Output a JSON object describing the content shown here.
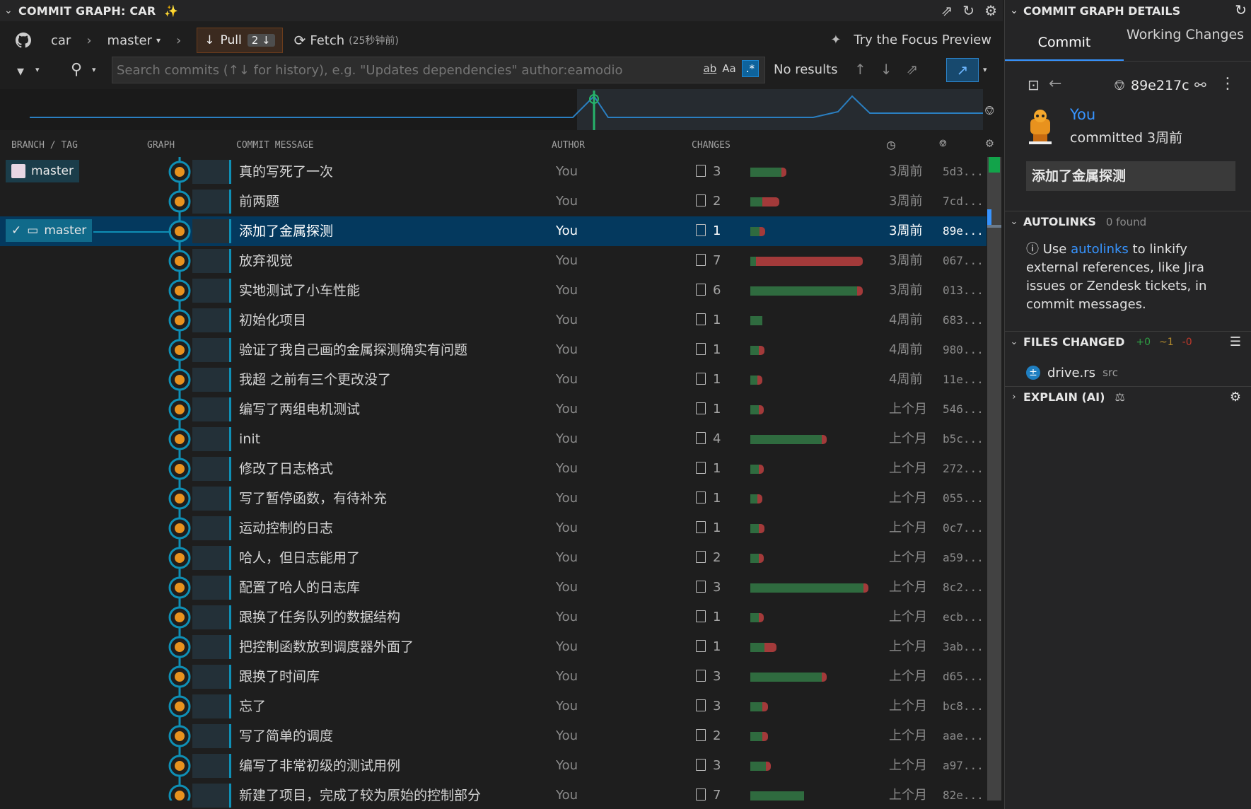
{
  "left_panel": {
    "title": "COMMIT GRAPH: CAR",
    "toolbar": {
      "repo": "car",
      "branch": "master",
      "pull_label": "Pull",
      "pull_count": "2",
      "fetch_label": "Fetch",
      "fetch_time": "(25秒钟前)",
      "focus_preview": "Try the Focus Preview"
    },
    "search": {
      "placeholder": "Search commits (↑↓ for history), e.g. \"Updates dependencies\" author:eamodio",
      "opt_match_word": "ab",
      "opt_match_case": "Aa",
      "opt_regex": ".*",
      "results": "No results"
    },
    "columns": {
      "branch_tag": "BRANCH / TAG",
      "graph": "GRAPH",
      "message": "COMMIT MESSAGE",
      "author": "AUTHOR",
      "changes": "CHANGES"
    },
    "branch_labels": {
      "remote_master": "master",
      "local_master": "master"
    },
    "colors": {
      "accent": "#0f8fb5",
      "additions": "#2f6b3f",
      "deletions": "#a33a3a",
      "selected_row": "#04395e"
    },
    "commits": [
      {
        "message": "真的写死了一次",
        "author": "You",
        "files": "3",
        "add": 0.26,
        "del": 0.04,
        "date": "3周前",
        "sha": "5d3..."
      },
      {
        "message": "前两题",
        "author": "You",
        "files": "2",
        "add": 0.1,
        "del": 0.14,
        "date": "3周前",
        "sha": "7cd..."
      },
      {
        "message": "添加了金属探测",
        "author": "You",
        "files": "1",
        "add": 0.08,
        "del": 0.05,
        "date": "3周前",
        "sha": "89e...",
        "selected": true
      },
      {
        "message": "放弃视觉",
        "author": "You",
        "files": "7",
        "add": 0.05,
        "del": 0.9,
        "date": "3周前",
        "sha": "067..."
      },
      {
        "message": "实地测试了小车性能",
        "author": "You",
        "files": "6",
        "add": 0.9,
        "del": 0.05,
        "date": "3周前",
        "sha": "013..."
      },
      {
        "message": "初始化项目",
        "author": "You",
        "files": "1",
        "add": 0.1,
        "del": 0,
        "date": "4周前",
        "sha": "683..."
      },
      {
        "message": "验证了我自己画的金属探测确实有问题",
        "author": "You",
        "files": "1",
        "add": 0.07,
        "del": 0.05,
        "date": "4周前",
        "sha": "980..."
      },
      {
        "message": "我超 之前有三个更改没了",
        "author": "You",
        "files": "1",
        "add": 0.06,
        "del": 0.04,
        "date": "4周前",
        "sha": "11e..."
      },
      {
        "message": "编写了两组电机测试",
        "author": "You",
        "files": "1",
        "add": 0.07,
        "del": 0.04,
        "date": "上个月",
        "sha": "546..."
      },
      {
        "message": "init",
        "author": "You",
        "files": "4",
        "add": 0.6,
        "del": 0.04,
        "date": "上个月",
        "sha": "b5c..."
      },
      {
        "message": "修改了日志格式",
        "author": "You",
        "files": "1",
        "add": 0.07,
        "del": 0.04,
        "date": "上个月",
        "sha": "272..."
      },
      {
        "message": "写了暂停函数，有待补充",
        "author": "You",
        "files": "1",
        "add": 0.06,
        "del": 0.04,
        "date": "上个月",
        "sha": "055..."
      },
      {
        "message": "运动控制的日志",
        "author": "You",
        "files": "1",
        "add": 0.07,
        "del": 0.05,
        "date": "上个月",
        "sha": "0c7..."
      },
      {
        "message": "哈人，但日志能用了",
        "author": "You",
        "files": "2",
        "add": 0.07,
        "del": 0.04,
        "date": "上个月",
        "sha": "a59..."
      },
      {
        "message": "配置了哈人的日志库",
        "author": "You",
        "files": "3",
        "add": 0.95,
        "del": 0.04,
        "date": "上个月",
        "sha": "8c2..."
      },
      {
        "message": "跟换了任务队列的数据结构",
        "author": "You",
        "files": "1",
        "add": 0.07,
        "del": 0.04,
        "date": "上个月",
        "sha": "ecb..."
      },
      {
        "message": "把控制函数放到调度器外面了",
        "author": "You",
        "files": "1",
        "add": 0.12,
        "del": 0.1,
        "date": "上个月",
        "sha": "3ab..."
      },
      {
        "message": "跟换了时间库",
        "author": "You",
        "files": "3",
        "add": 0.6,
        "del": 0.04,
        "date": "上个月",
        "sha": "d65..."
      },
      {
        "message": "忘了",
        "author": "You",
        "files": "3",
        "add": 0.1,
        "del": 0.05,
        "date": "上个月",
        "sha": "bc8..."
      },
      {
        "message": "写了简单的调度",
        "author": "You",
        "files": "2",
        "add": 0.1,
        "del": 0.05,
        "date": "上个月",
        "sha": "aae..."
      },
      {
        "message": "编写了非常初级的测试用例",
        "author": "You",
        "files": "3",
        "add": 0.13,
        "del": 0.04,
        "date": "上个月",
        "sha": "a97..."
      },
      {
        "message": "新建了项目，完成了较为原始的控制部分",
        "author": "You",
        "files": "7",
        "add": 0.45,
        "del": 0,
        "date": "上个月",
        "sha": "82e..."
      }
    ]
  },
  "right_panel": {
    "title": "COMMIT GRAPH DETAILS",
    "tab_commit": "Commit",
    "tab_working": "Working Changes",
    "sha": "89e217c",
    "author": "You",
    "committed": "committed 3周前",
    "message": "添加了金属探测",
    "autolinks": {
      "title": "AUTOLINKS",
      "count": "0 found",
      "text_before": "Use ",
      "link": "autolinks",
      "text_after": " to linkify external references, like Jira issues or Zendesk tickets, in commit messages."
    },
    "files_changed": {
      "title": "FILES CHANGED",
      "added": "+0",
      "modified": "~1",
      "deleted": "-0",
      "file_name": "drive.rs",
      "file_dir": "src"
    },
    "explain": {
      "title": "EXPLAIN (AI)"
    }
  }
}
